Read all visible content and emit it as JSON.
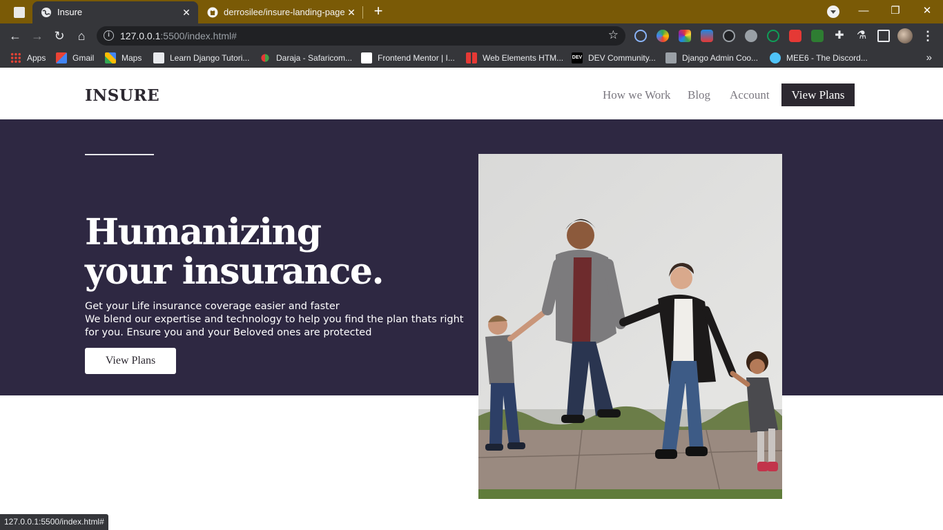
{
  "tabs": [
    {
      "title": "Insure",
      "active": true,
      "icon": "globe-icon"
    },
    {
      "title": "derrosilee/insure-landing-page-m",
      "active": false,
      "icon": "github-icon"
    }
  ],
  "toolbar": {
    "url_host": "127.0.0.1",
    "url_rest": ":5500/index.html#"
  },
  "bookmarks": [
    {
      "label": "Apps",
      "icon": "apps-grid-icon"
    },
    {
      "label": "Gmail",
      "icon": "gmail-icon"
    },
    {
      "label": "Maps",
      "icon": "maps-icon"
    },
    {
      "label": "Learn Django Tutori...",
      "icon": "bookmark-favicon-icon"
    },
    {
      "label": "Daraja - Safaricom...",
      "icon": "bookmark-favicon-icon"
    },
    {
      "label": "Frontend Mentor | I...",
      "icon": "bookmark-favicon-icon"
    },
    {
      "label": "Web Elements HTM...",
      "icon": "bookmark-favicon-icon"
    },
    {
      "label": "DEV Community...",
      "icon": "dev-icon"
    },
    {
      "label": "Django Admin Coo...",
      "icon": "bookmark-favicon-icon"
    },
    {
      "label": "MEE6 - The Discord...",
      "icon": "mee6-icon"
    }
  ],
  "site": {
    "logo": "INSURE",
    "nav": [
      "How we Work",
      "Blog",
      "Account"
    ],
    "nav_cta": "View Plans",
    "hero": {
      "title_line1": "Humanizing",
      "title_line2": "your insurance.",
      "text_line1": "Get your Life insurance coverage easier and faster",
      "text_line2": "We blend our expertise and technology to help you find the plan thats right for you. Ensure you and your Beloved ones are protected",
      "button": "View Plans"
    }
  },
  "status_bar": "127.0.0.1:5500/index.html#",
  "colors": {
    "tab_strip": "#7a5a06",
    "chrome": "#35363a",
    "hero_bg": "#2e2842",
    "dark_text": "#2c2830"
  }
}
